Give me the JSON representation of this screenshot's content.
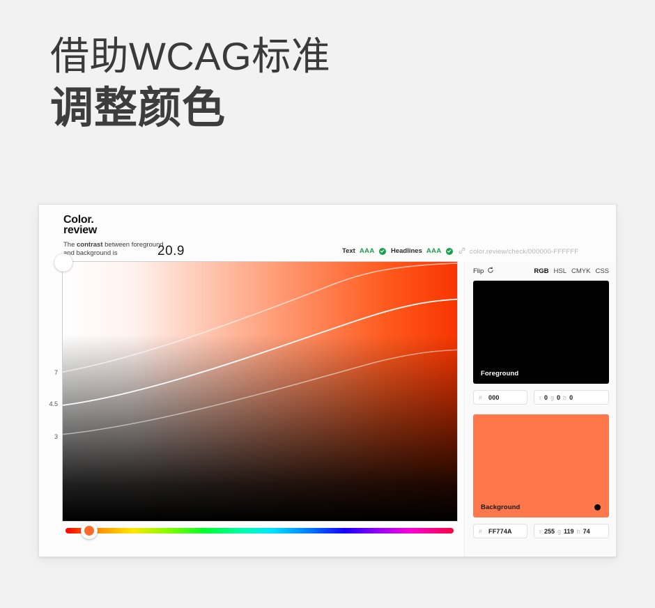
{
  "page": {
    "background_color": "#f2f2f2",
    "headline_line1": "借助WCAG标准",
    "headline_line2": "调整颜色"
  },
  "app": {
    "brand_line1": "Color.",
    "brand_line2": "review",
    "contrast_sentence_prefix": "The ",
    "contrast_sentence_bold": "contrast",
    "contrast_sentence_suffix": " between foreground and background is",
    "contrast_value": "20.9",
    "ratings": [
      {
        "label": "Text",
        "grade": "AAA",
        "status_color": "#17a04a"
      },
      {
        "label": "Headlines",
        "grade": "AAA",
        "status_color": "#17a04a"
      }
    ],
    "url": "color.review/check/000000-FFFFFF",
    "axis_ticks": [
      {
        "label": "7",
        "top_pct": 41.5
      },
      {
        "label": "4.5",
        "top_pct": 53.5
      },
      {
        "label": "3",
        "top_pct": 66.0
      }
    ],
    "hue_slider": {
      "handle_color": "#ff6a2a",
      "handle_position_pct": 4
    },
    "panel": {
      "flip_label": "Flip",
      "mode_tabs": [
        {
          "label": "RGB",
          "active": true
        },
        {
          "label": "HSL",
          "active": false
        },
        {
          "label": "CMYK",
          "active": false
        },
        {
          "label": "CSS",
          "active": false
        }
      ],
      "foreground": {
        "swatch_label": "Foreground",
        "color": "#000000",
        "hex_key": "#",
        "hex_value": "000",
        "r_key": "r",
        "r_value": "0",
        "g_key": "g",
        "g_value": "0",
        "b_key": "b",
        "b_value": "0"
      },
      "background": {
        "swatch_label": "Background",
        "color": "#ff774a",
        "hex_key": "#",
        "hex_value": "FF774A",
        "r_key": "r",
        "r_value": "255",
        "g_key": "g",
        "g_value": "119",
        "b_key": "b",
        "b_value": "74"
      }
    }
  }
}
